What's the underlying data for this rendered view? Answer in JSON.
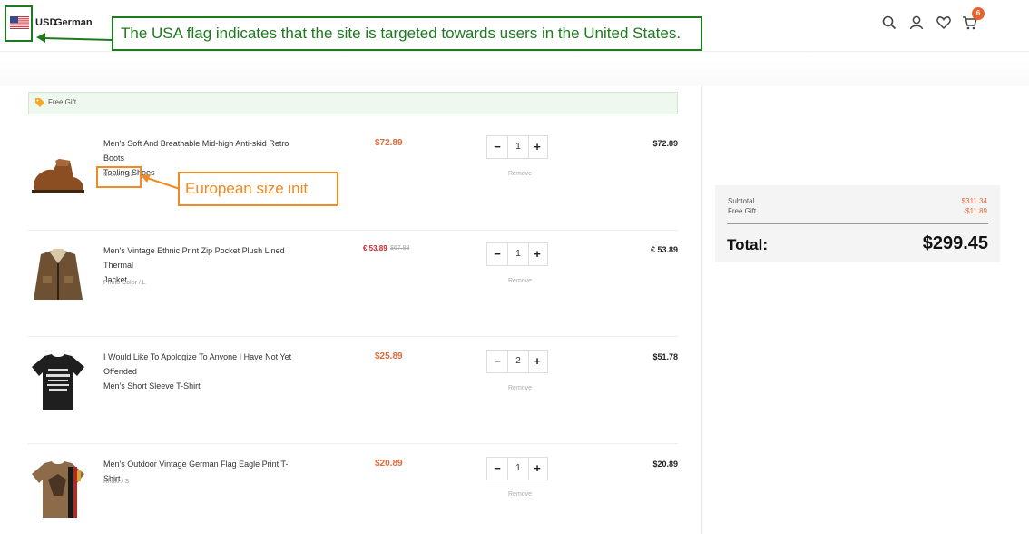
{
  "header": {
    "currency": "USD",
    "language": "German",
    "cart_count": "6"
  },
  "annotations": {
    "flag_note": "The USA flag indicates that the site is targeted towards users in the United States.",
    "size_note": "European size init"
  },
  "free_gift": {
    "label": "Free Gift"
  },
  "cart": {
    "remove_label": "Remove",
    "items": [
      {
        "name_line1": "Men's Soft And Breathable Mid-high Anti-skid Retro Boots",
        "name_line2": "Tooling Shoes",
        "variant": "Brown / 42",
        "price": "$72.89",
        "quantity": "1",
        "total": "$72.89"
      },
      {
        "name_line1": "Men's Vintage Ethnic Print Zip Pocket Plush Lined Thermal",
        "name_line2": "Jacket",
        "variant": "Photo Color / L",
        "price": "€ 53.89",
        "old_price": "$67.89",
        "quantity": "1",
        "total": "€ 53.89"
      },
      {
        "name_line1": "I Would Like To Apologize To Anyone I Have Not Yet Offended",
        "name_line2": "Men's Short Sleeve T-Shirt",
        "variant": "",
        "price": "$25.89",
        "quantity": "2",
        "total": "$51.78"
      },
      {
        "name_line1": "Men's Outdoor Vintage German Flag Eagle Print T-Shirt",
        "name_line2": "",
        "variant": "Khaki / S",
        "price": "$20.89",
        "quantity": "1",
        "total": "$20.89"
      }
    ]
  },
  "summary": {
    "subtotal_label": "Subtotal",
    "subtotal_value": "$311.34",
    "free_gift_label": "Free Gift",
    "free_gift_value": "-$11.89",
    "total_label": "Total:",
    "total_value": "$299.45"
  },
  "colors": {
    "accent": "#e0693a",
    "annotation_green": "#1e7a1e",
    "annotation_orange": "#f08a24",
    "badge": "#e8622c"
  },
  "icons": [
    "us-flag-icon",
    "search-icon",
    "user-icon",
    "heart-icon",
    "cart-icon",
    "tag-icon"
  ]
}
